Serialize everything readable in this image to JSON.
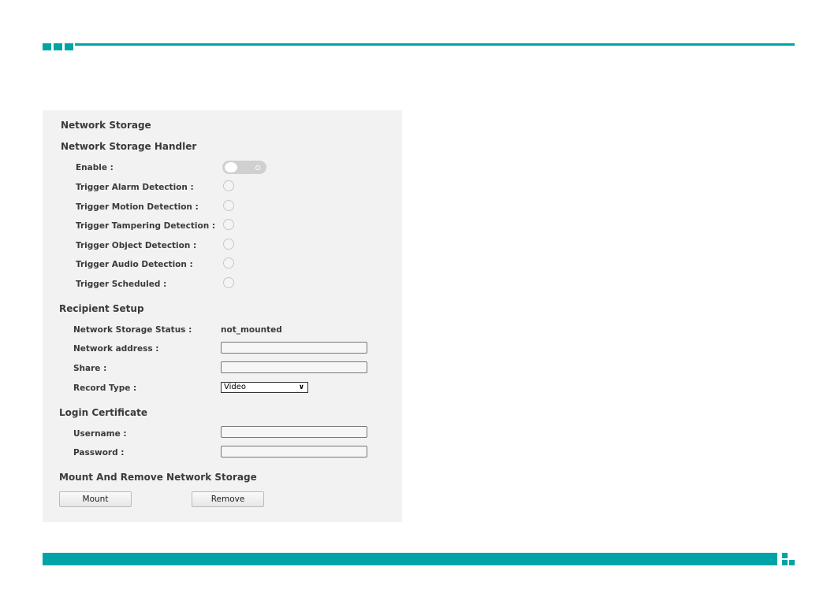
{
  "colors": {
    "accent": "#00a3a6",
    "panel_bg": "#f2f2f2"
  },
  "panel": {
    "title": "Network Storage",
    "handler": {
      "heading": "Network Storage Handler",
      "enable_label": "Enable :",
      "enable_on": false,
      "triggers": [
        {
          "label": "Trigger Alarm Detection :",
          "checked": false
        },
        {
          "label": "Trigger Motion Detection :",
          "checked": false
        },
        {
          "label": "Trigger Tampering Detection :",
          "checked": false
        },
        {
          "label": "Trigger Object Detection :",
          "checked": false
        },
        {
          "label": "Trigger Audio Detection :",
          "checked": false
        },
        {
          "label": "Trigger Scheduled :",
          "checked": false
        }
      ]
    },
    "recipient": {
      "heading": "Recipient Setup",
      "status_label": "Network Storage Status :",
      "status_value": "not_mounted",
      "address_label": "Network address :",
      "address_value": "",
      "share_label": "Share :",
      "share_value": "",
      "record_type_label": "Record Type :",
      "record_type_value": "Video"
    },
    "login": {
      "heading": "Login Certificate",
      "username_label": "Username :",
      "username_value": "",
      "password_label": "Password :",
      "password_value": ""
    },
    "mount": {
      "heading": "Mount And Remove Network Storage",
      "mount_label": "Mount",
      "remove_label": "Remove"
    }
  }
}
